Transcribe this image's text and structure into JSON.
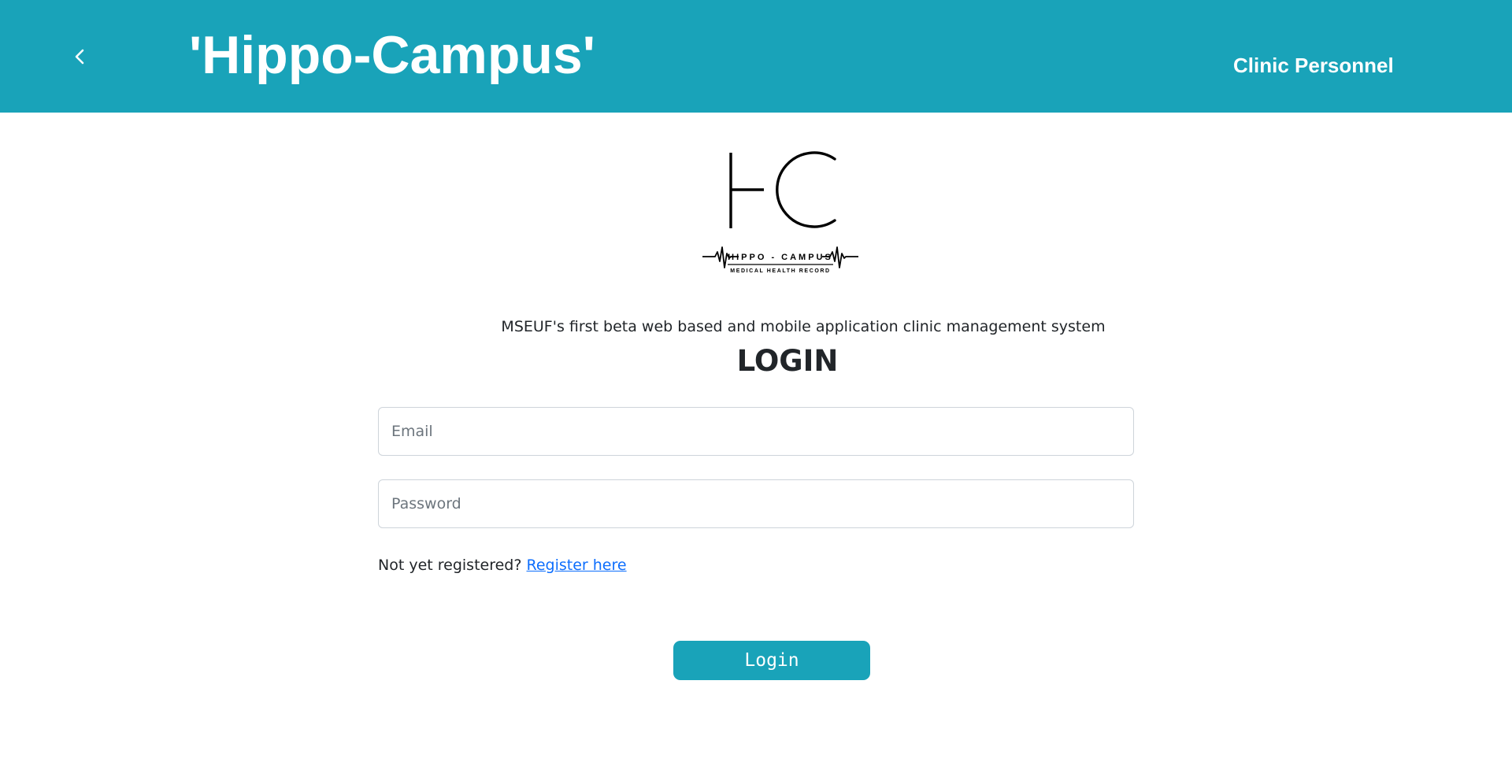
{
  "header": {
    "back_icon": "chevron-left-icon",
    "title": "'Hippo-Campus'",
    "role": "Clinic Personnel",
    "background_color": "#19a3b9"
  },
  "logo": {
    "monogram": "HC",
    "name": "HIPPO - CAMPUS",
    "subtitle": "MEDICAL HEALTH RECORD"
  },
  "main": {
    "tagline": "MSEUF's first beta web based and mobile application clinic management system",
    "heading": "LOGIN",
    "email": {
      "placeholder": "Email",
      "value": ""
    },
    "password": {
      "placeholder": "Password",
      "value": ""
    },
    "register_prompt": "Not yet registered?",
    "register_link": "Register here",
    "login_button": "Login",
    "link_color": "#0d6efd"
  }
}
